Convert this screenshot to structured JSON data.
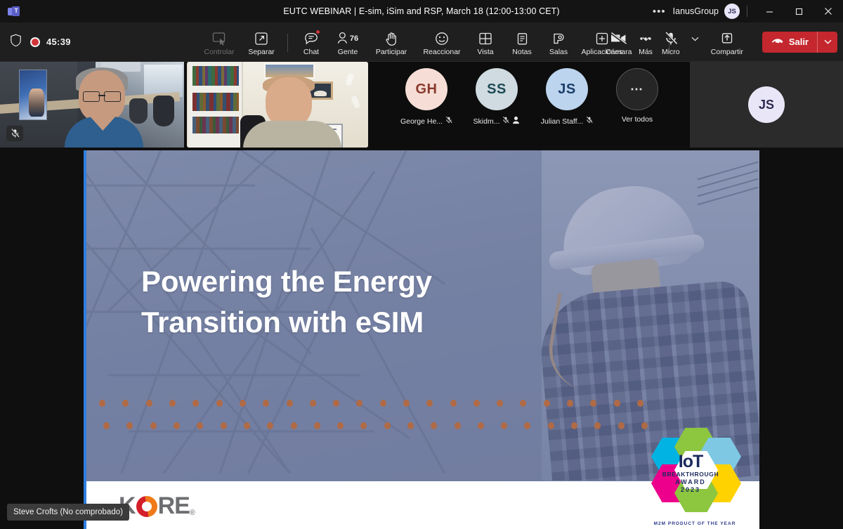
{
  "titlebar": {
    "app_icon": "teams-logo-icon",
    "meeting_title": "EUTC WEBINAR | E-sim, iSim and RSP, March 18 (12:00-13:00 CET)",
    "overflow": "•••",
    "org_name": "IanusGroup",
    "account_initials": "JS",
    "minimize_label": "Minimizar",
    "maximize_label": "Maximizar",
    "close_label": "Cerrar"
  },
  "toolbar": {
    "shield_icon": "shield-icon",
    "recording_time": "45:39",
    "items": [
      {
        "label": "Controlar",
        "icon": "give-control-icon",
        "disabled": true
      },
      {
        "label": "Separar",
        "icon": "pop-out-icon",
        "disabled": false
      },
      {
        "label": "Chat",
        "icon": "chat-icon",
        "badge": true,
        "disabled": false
      },
      {
        "label": "Gente",
        "icon": "people-icon",
        "count": "76",
        "disabled": false
      },
      {
        "label": "Participar",
        "icon": "raise-hand-icon",
        "disabled": false
      },
      {
        "label": "Reaccionar",
        "icon": "reactions-icon",
        "disabled": false
      },
      {
        "label": "Vista",
        "icon": "view-grid-icon",
        "disabled": false
      },
      {
        "label": "Notas",
        "icon": "notes-icon",
        "disabled": false
      },
      {
        "label": "Salas",
        "icon": "breakout-rooms-icon",
        "disabled": false
      },
      {
        "label": "Aplicaciones",
        "icon": "apps-plus-icon",
        "disabled": false
      },
      {
        "label": "Más",
        "icon": "more-ellipsis-icon",
        "disabled": false
      }
    ],
    "camera": {
      "label": "Cámara",
      "icon": "camera-off-icon",
      "state": "off"
    },
    "mic": {
      "label": "Micro",
      "icon": "mic-off-icon",
      "state": "muted"
    },
    "share": {
      "label": "Compartir",
      "icon": "share-screen-icon"
    },
    "leave": {
      "label": "Salir",
      "icon": "hangup-icon",
      "color": "#c4272e"
    }
  },
  "roster": {
    "video_tiles": [
      {
        "name": "video-tile-1",
        "muted": true,
        "active_speaker": false
      },
      {
        "name": "video-tile-2",
        "muted": false,
        "active_speaker": true
      }
    ],
    "participants": [
      {
        "initials": "GH",
        "name": "George He...",
        "muted": true,
        "presenter": false,
        "bg": "#f6ded6",
        "fg": "#8a3a2c"
      },
      {
        "initials": "SS",
        "name": "Skidm...",
        "muted": true,
        "presenter": true,
        "bg": "#cfdbe0",
        "fg": "#1f4a55"
      },
      {
        "initials": "JS",
        "name": "Julian Staff...",
        "muted": true,
        "presenter": false,
        "bg": "#bcd4ee",
        "fg": "#1d3f6b"
      }
    ],
    "see_all": {
      "label": "Ver todos",
      "icon": "more-ellipsis-icon"
    },
    "self_tile": {
      "initials": "JS"
    }
  },
  "shared_content": {
    "border_color": "#2f7fe0",
    "slide_title_line1": "Powering the Energy",
    "slide_title_line2": "Transition with eSIM",
    "brand": {
      "name": "KORE",
      "registered": "®"
    },
    "award": {
      "line1": "IoT",
      "line2": "BREAKTHROUGH",
      "line3": "AWARD",
      "line4": "2023",
      "caption": "M2M PRODUCT OF THE YEAR"
    },
    "dot_color": "#b06a45",
    "dots_per_row": 24
  },
  "toast": {
    "speaker_label": "Steve Crofts (No comprobado)"
  }
}
